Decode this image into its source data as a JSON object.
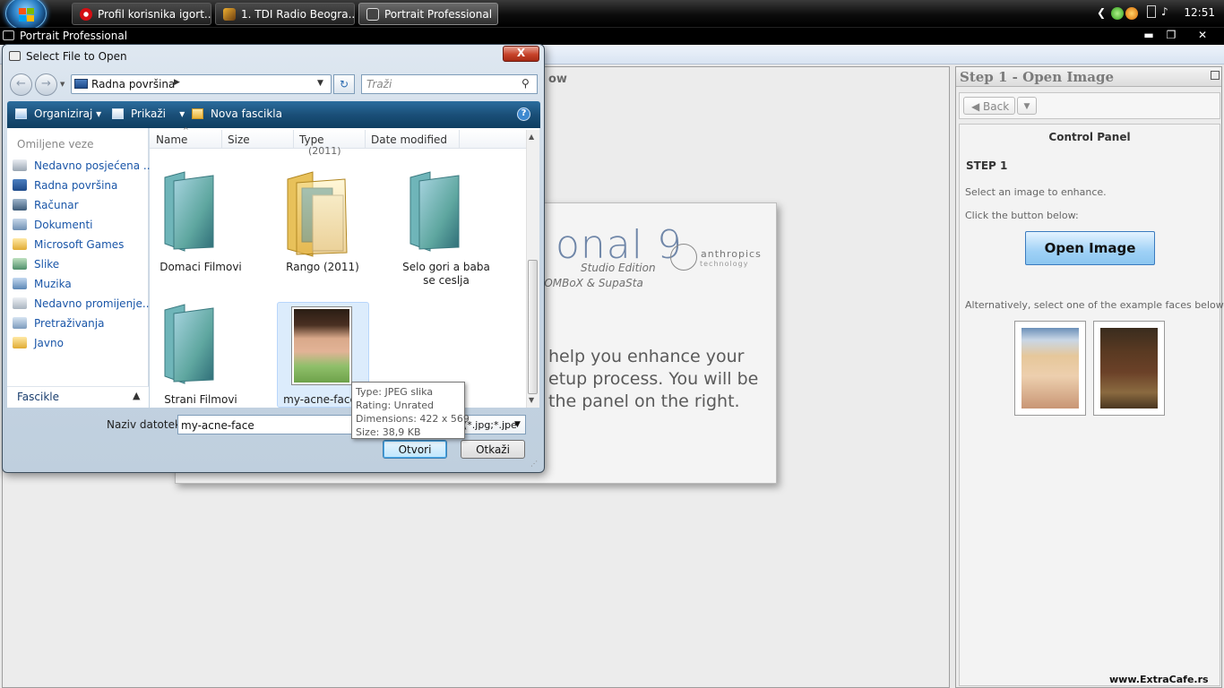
{
  "taskbar": {
    "buttons": [
      {
        "label": "Profil korisnika igort..."
      },
      {
        "label": "1. TDI Radio Beogra..."
      },
      {
        "label": "Portrait Professional"
      }
    ],
    "clock": "12:51",
    "icons": [
      "start-orb-icon",
      "opera-icon",
      "winamp-icon",
      "camera-icon",
      "tray-expand-icon",
      "network-icon",
      "volume-icon"
    ]
  },
  "app": {
    "title": "Portrait Professional",
    "workspace_label": "ow",
    "splash": {
      "title": "onal 9",
      "edition": "Studio Edition",
      "credit": "oOMBoX & SupaSta",
      "logo_name": "anthropics",
      "logo_sub": "technology",
      "lines": [
        "help you enhance your",
        "etup process. You will be",
        "the panel on the right."
      ]
    }
  },
  "step_panel": {
    "title": "Step 1 - Open Image",
    "back_label": "Back",
    "control_panel_title": "Control Panel",
    "step_label": "STEP 1",
    "text_select": "Select an image to enhance.",
    "text_click": "Click the button below:",
    "open_button": "Open Image",
    "text_alt": "Alternatively, select one of the example faces below:"
  },
  "dialog": {
    "title": "Select File to Open",
    "close_label": "X",
    "address": "Radna površina",
    "search_placeholder": "Traži",
    "toolbar": {
      "organize": "Organiziraj",
      "views": "Prikaži",
      "new_folder": "Nova fascikla"
    },
    "favorites_header": "Omiljene veze",
    "favorites": [
      {
        "label": "Nedavno posjećena ..."
      },
      {
        "label": "Radna površina"
      },
      {
        "label": "Računar"
      },
      {
        "label": "Dokumenti"
      },
      {
        "label": "Microsoft Games"
      },
      {
        "label": "Slike"
      },
      {
        "label": "Muzika"
      },
      {
        "label": "Nedavno promijenje..."
      },
      {
        "label": "Pretraživanja"
      },
      {
        "label": "Javno"
      }
    ],
    "folders_label": "Fascikle",
    "columns": [
      "Name",
      "Size",
      "Type",
      "Date modified"
    ],
    "partial_caption": "(2011)",
    "files": [
      {
        "name": "Domaci Filmovi"
      },
      {
        "name": "Rango (2011)"
      },
      {
        "name": "Selo gori a baba se ceslja"
      },
      {
        "name": "Strani Filmovi"
      },
      {
        "name": "my-acne-face"
      }
    ],
    "filename_label": "Naziv datoteke:",
    "filename_value": "my-acne-face",
    "filetype_value": "(*.jpg;*.jpe",
    "open_button": "Otvori",
    "cancel_button": "Otkaži"
  },
  "tooltip": {
    "type": "Type: JPEG slika",
    "rating": "Rating: Unrated",
    "dimensions": "Dimensions: 422 x 569",
    "size": "Size: 38,9 KB"
  },
  "watermark": "www.ExtraCafe.rs",
  "colors": {
    "dialog_toolbar": "#1a4f78",
    "link_blue": "#1a56a8",
    "open_image_button": "#9fd1f6"
  }
}
